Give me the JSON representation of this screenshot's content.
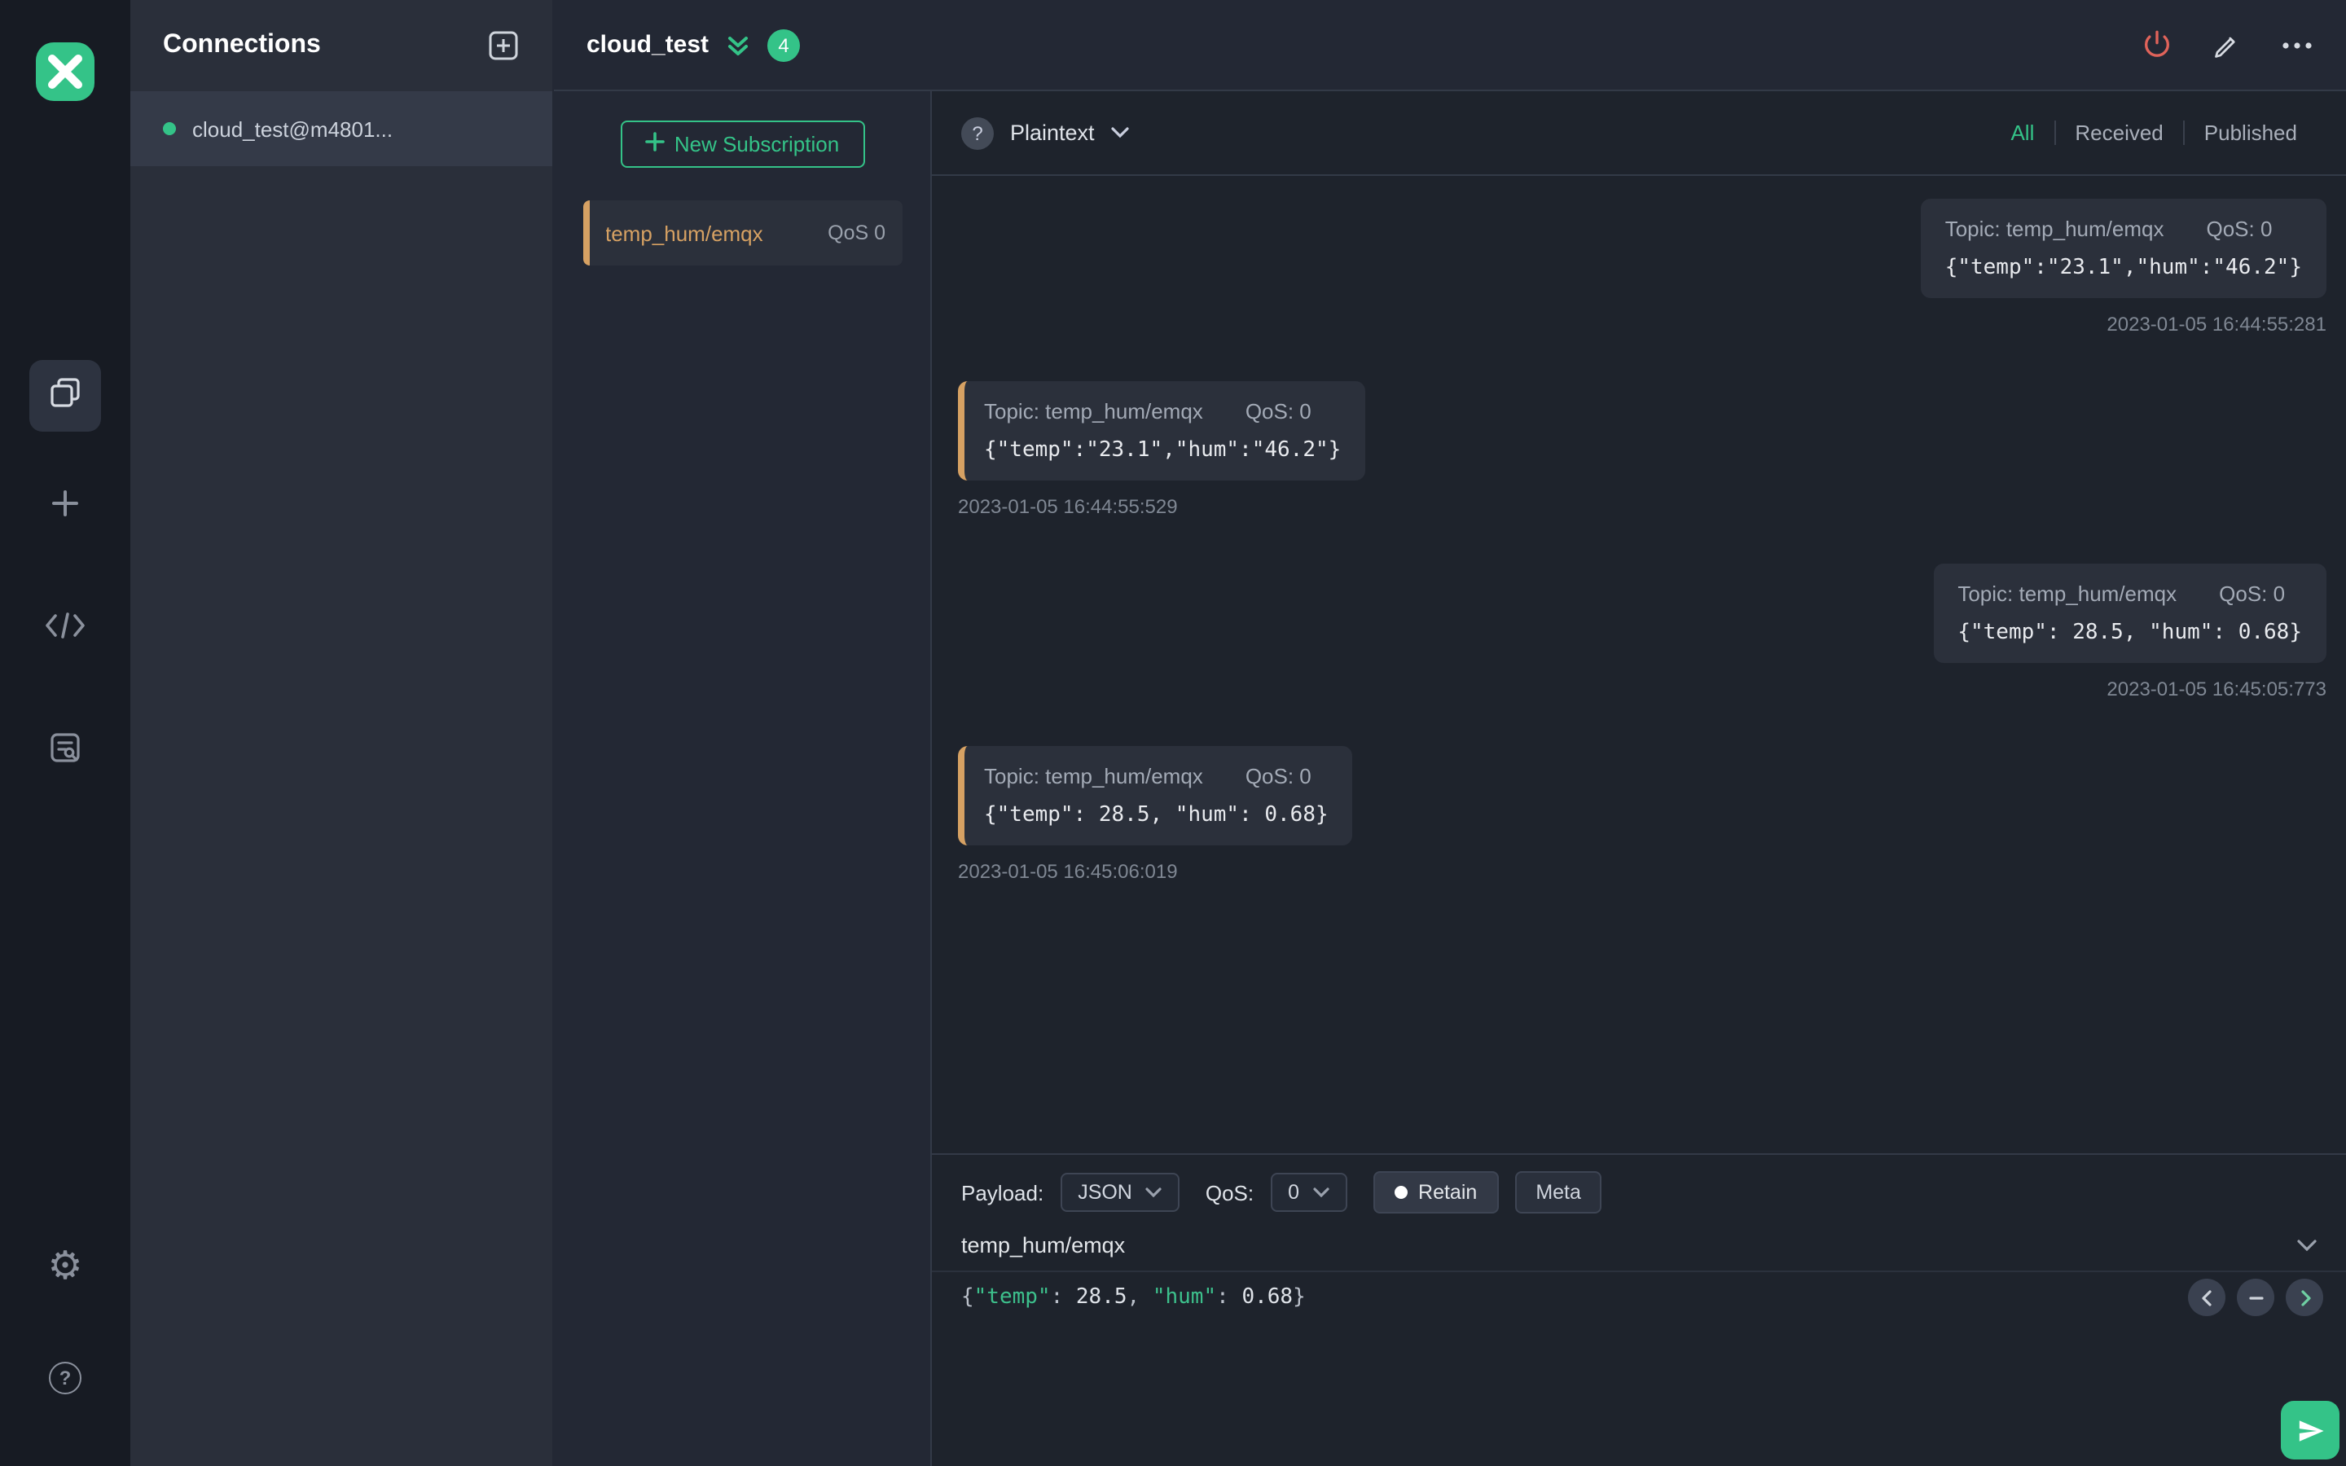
{
  "colors": {
    "accent_green": "#34c388",
    "subscription_orange": "#d6a163",
    "power_red": "#e0635a"
  },
  "connections": {
    "title": "Connections",
    "items": [
      {
        "name": "cloud_test@m4801...",
        "connected": true
      }
    ]
  },
  "header": {
    "title": "cloud_test",
    "badge": "4"
  },
  "subscriptions": {
    "new_button_label": "New Subscription",
    "items": [
      {
        "topic": "temp_hum/emqx",
        "qos": "QoS 0"
      }
    ]
  },
  "messages": {
    "format": "Plaintext",
    "filters": [
      {
        "label": "All",
        "active": true
      },
      {
        "label": "Received",
        "active": false
      },
      {
        "label": "Published",
        "active": false
      }
    ],
    "items": [
      {
        "direction": "published",
        "topic_label": "Topic: temp_hum/emqx",
        "qos_label": "QoS: 0",
        "payload": "{\"temp\":\"23.1\",\"hum\":\"46.2\"}",
        "timestamp": "2023-01-05 16:44:55:281"
      },
      {
        "direction": "received",
        "topic_label": "Topic: temp_hum/emqx",
        "qos_label": "QoS: 0",
        "payload": "{\"temp\":\"23.1\",\"hum\":\"46.2\"}",
        "timestamp": "2023-01-05 16:44:55:529"
      },
      {
        "direction": "published",
        "topic_label": "Topic: temp_hum/emqx",
        "qos_label": "QoS: 0",
        "payload": "{\"temp\": 28.5, \"hum\": 0.68}",
        "timestamp": "2023-01-05 16:45:05:773"
      },
      {
        "direction": "received",
        "topic_label": "Topic: temp_hum/emqx",
        "qos_label": "QoS: 0",
        "payload": "{\"temp\": 28.5, \"hum\": 0.68}",
        "timestamp": "2023-01-05 16:45:06:019"
      }
    ]
  },
  "publish": {
    "payload_label": "Payload:",
    "format": "JSON",
    "qos_label": "QoS:",
    "qos": "0",
    "retain_label": "Retain",
    "meta_label": "Meta",
    "topic": "temp_hum/emqx",
    "editor": {
      "raw": "{\"temp\": 28.5, \"hum\": 0.68}",
      "segments": [
        {
          "text": "{",
          "type": "punct"
        },
        {
          "text": "\"temp\"",
          "type": "key"
        },
        {
          "text": ": ",
          "type": "punct"
        },
        {
          "text": "28.5",
          "type": "number"
        },
        {
          "text": ", ",
          "type": "punct"
        },
        {
          "text": "\"hum\"",
          "type": "key"
        },
        {
          "text": ": ",
          "type": "punct"
        },
        {
          "text": "0.68",
          "type": "number"
        },
        {
          "text": "}",
          "type": "punct"
        }
      ]
    }
  }
}
